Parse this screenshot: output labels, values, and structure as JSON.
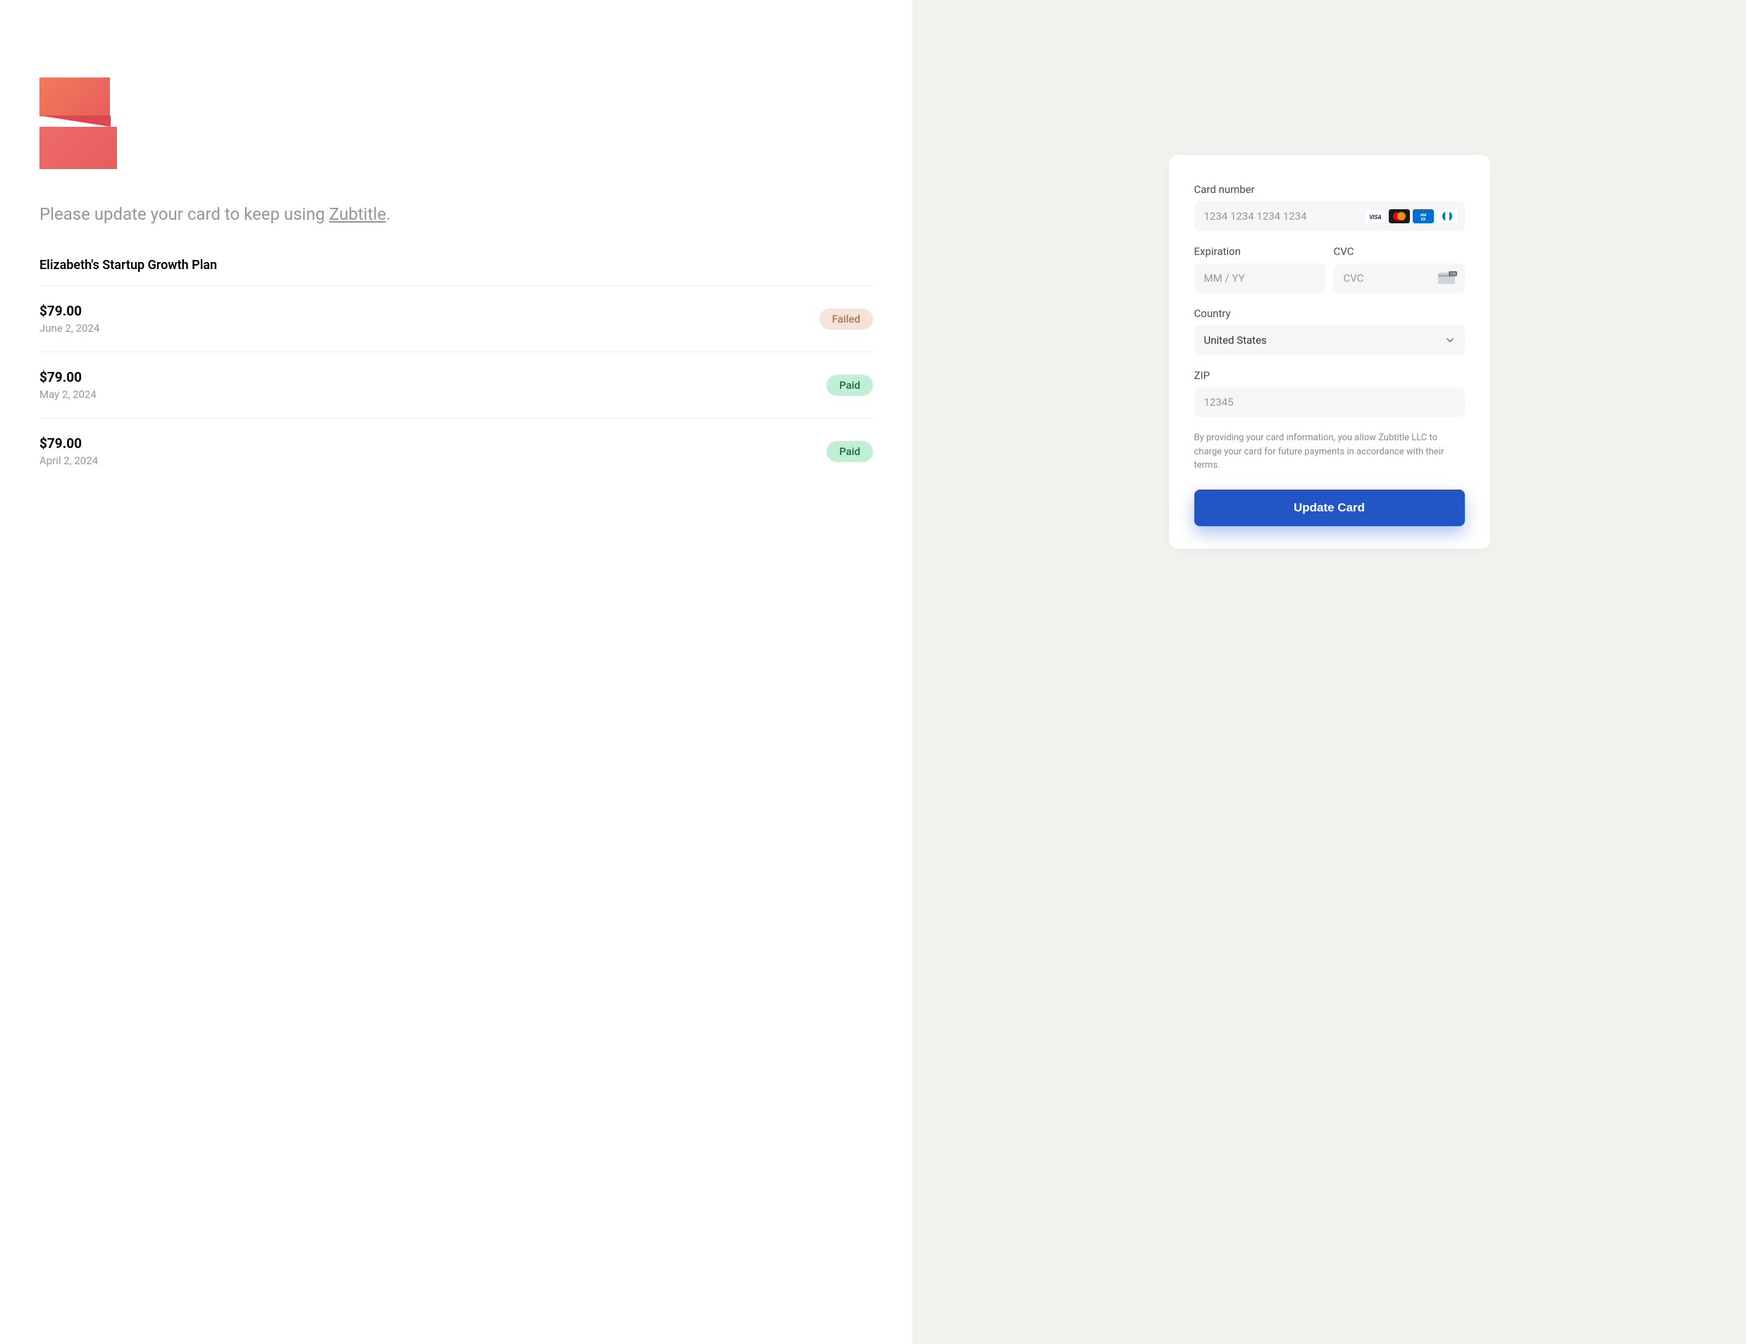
{
  "headline_prefix": "Please update your card to keep using ",
  "brand": "Zubtitle",
  "headline_suffix": ".",
  "plan_name": "Elizabeth's Startup Growth Plan",
  "invoices": [
    {
      "amount": "$79.00",
      "date": "June 2, 2024",
      "status": "Failed",
      "status_class": "failed"
    },
    {
      "amount": "$79.00",
      "date": "May 2, 2024",
      "status": "Paid",
      "status_class": "paid"
    },
    {
      "amount": "$79.00",
      "date": "April 2, 2024",
      "status": "Paid",
      "status_class": "paid"
    }
  ],
  "form": {
    "card_number_label": "Card number",
    "card_number_placeholder": "1234 1234 1234 1234",
    "expiration_label": "Expiration",
    "expiration_placeholder": "MM / YY",
    "cvc_label": "CVC",
    "cvc_placeholder": "CVC",
    "country_label": "Country",
    "country_value": "United States",
    "zip_label": "ZIP",
    "zip_placeholder": "12345",
    "disclaimer": "By providing your card information, you allow Zubtitle LLC to charge your card for future payments in accordance with their terms.",
    "submit_label": "Update Card"
  }
}
